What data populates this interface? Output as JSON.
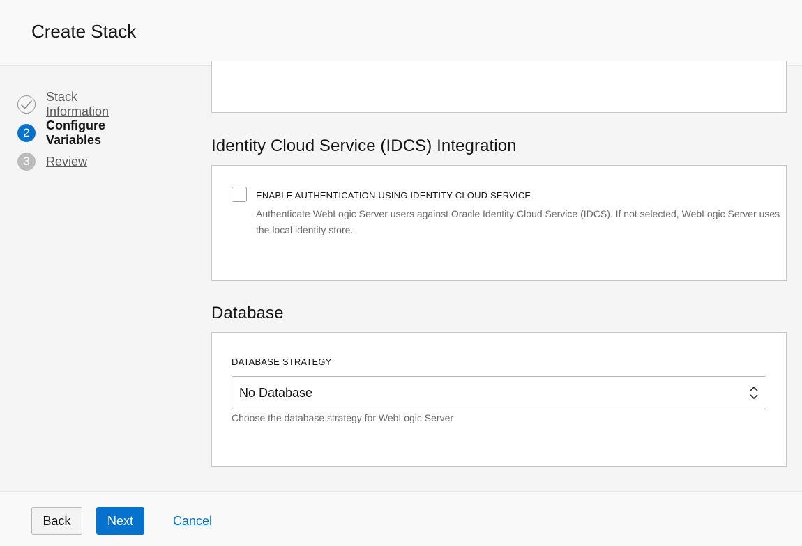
{
  "header": {
    "title": "Create Stack"
  },
  "steps": [
    {
      "label": "Stack Information",
      "number": "",
      "state": "done"
    },
    {
      "label": "Configure Variables",
      "number": "2",
      "state": "current"
    },
    {
      "label": "Review",
      "number": "3",
      "state": "todo"
    }
  ],
  "idcs": {
    "title": "Identity Cloud Service (IDCS) Integration",
    "checkbox_label": "ENABLE AUTHENTICATION USING IDENTITY CLOUD SERVICE",
    "checkbox_checked": false,
    "help": "Authenticate WebLogic Server users against Oracle Identity Cloud Service (IDCS). If not selected, WebLogic Server uses the local identity store."
  },
  "database": {
    "title": "Database",
    "field_label": "DATABASE STRATEGY",
    "selected": "No Database",
    "help": "Choose the database strategy for WebLogic Server"
  },
  "footer": {
    "back_label": "Back",
    "next_label": "Next",
    "cancel_label": "Cancel"
  },
  "colors": {
    "accent": "#0572ce",
    "background": "#f5f5f5"
  }
}
